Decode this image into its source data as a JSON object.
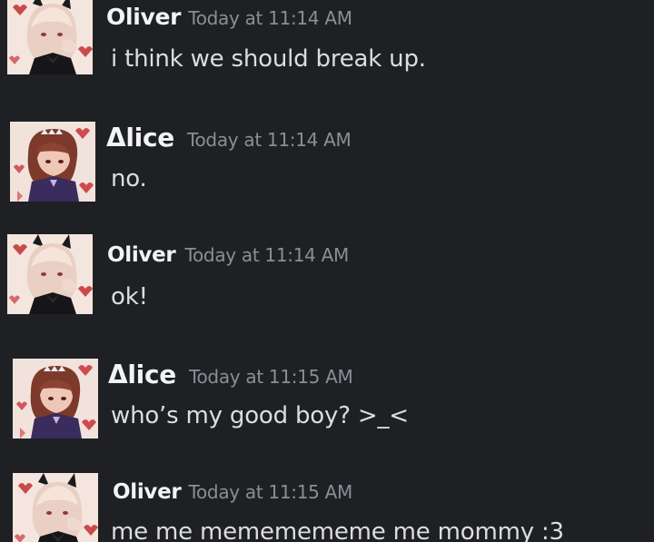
{
  "messages": [
    {
      "author": "Oliver",
      "timestamp": "Today at 11:14 AM",
      "text": "i think we should break up."
    },
    {
      "author": "Δlice",
      "timestamp": "Today at 11:14 AM",
      "text": "no."
    },
    {
      "author": "Oliver",
      "timestamp": "Today at 11:14 AM",
      "text": "ok!"
    },
    {
      "author": "Δlice",
      "timestamp": "Today at 11:15 AM",
      "text": "who’s my good boy? >_<"
    },
    {
      "author": "Oliver",
      "timestamp": "Today at 11:15 AM",
      "text": "me me mememememe me mommy :3"
    }
  ],
  "colors": {
    "background": "#1e2024",
    "username": "#f2f3f5",
    "timestamp": "#8b8e94",
    "message_text": "#dcdde0"
  },
  "icons": {
    "oliver_avatar": "anime-boy-avatar-icon",
    "alice_avatar": "anime-girl-avatar-icon"
  }
}
